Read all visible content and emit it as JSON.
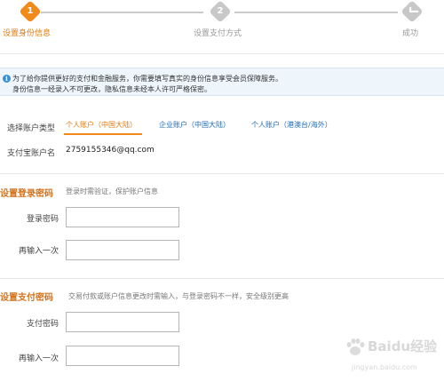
{
  "steps": {
    "step1": {
      "number": "1",
      "label": "设置身份信息"
    },
    "step2": {
      "number": "2",
      "label": "设置支付方式"
    },
    "step3": {
      "label": "成功"
    }
  },
  "notice": {
    "line1": "为了给你提供更好的支付和金融服务，你需要填写真实的身份信息享受会员保障服务。",
    "line2": "身份信息一经录入不可更改，隐私信息未经本人许可严格保密。"
  },
  "account": {
    "type_label": "选择账户类型",
    "options": [
      "个人账户（中国大陆）",
      "企业账户（中国大陆）",
      "个人账户（港澳台/海外）"
    ],
    "name_label": "支付宝账户名",
    "name_value": "2759155346@qq.com"
  },
  "login_password": {
    "title": "设置登录密码",
    "description": "登录时需验证，保护账户信息",
    "password_label": "登录密码",
    "repeat_label": "再输入一次",
    "password_value": "",
    "repeat_value": ""
  },
  "pay_password": {
    "title": "设置支付密码",
    "description": "交易付款或账户信息更改时需输入，与登录密码不一样，安全级别更高",
    "password_label": "支付密码",
    "repeat_label": "再输入一次",
    "password_value": "",
    "repeat_value": ""
  },
  "watermark": {
    "brand": "Baidu经验",
    "url": "jingyan.baidu.com"
  },
  "colors": {
    "accent": "#f28a1a",
    "section_title": "#d4731a",
    "link": "#1f6bb5",
    "notice_bg": "#eef6fc"
  }
}
